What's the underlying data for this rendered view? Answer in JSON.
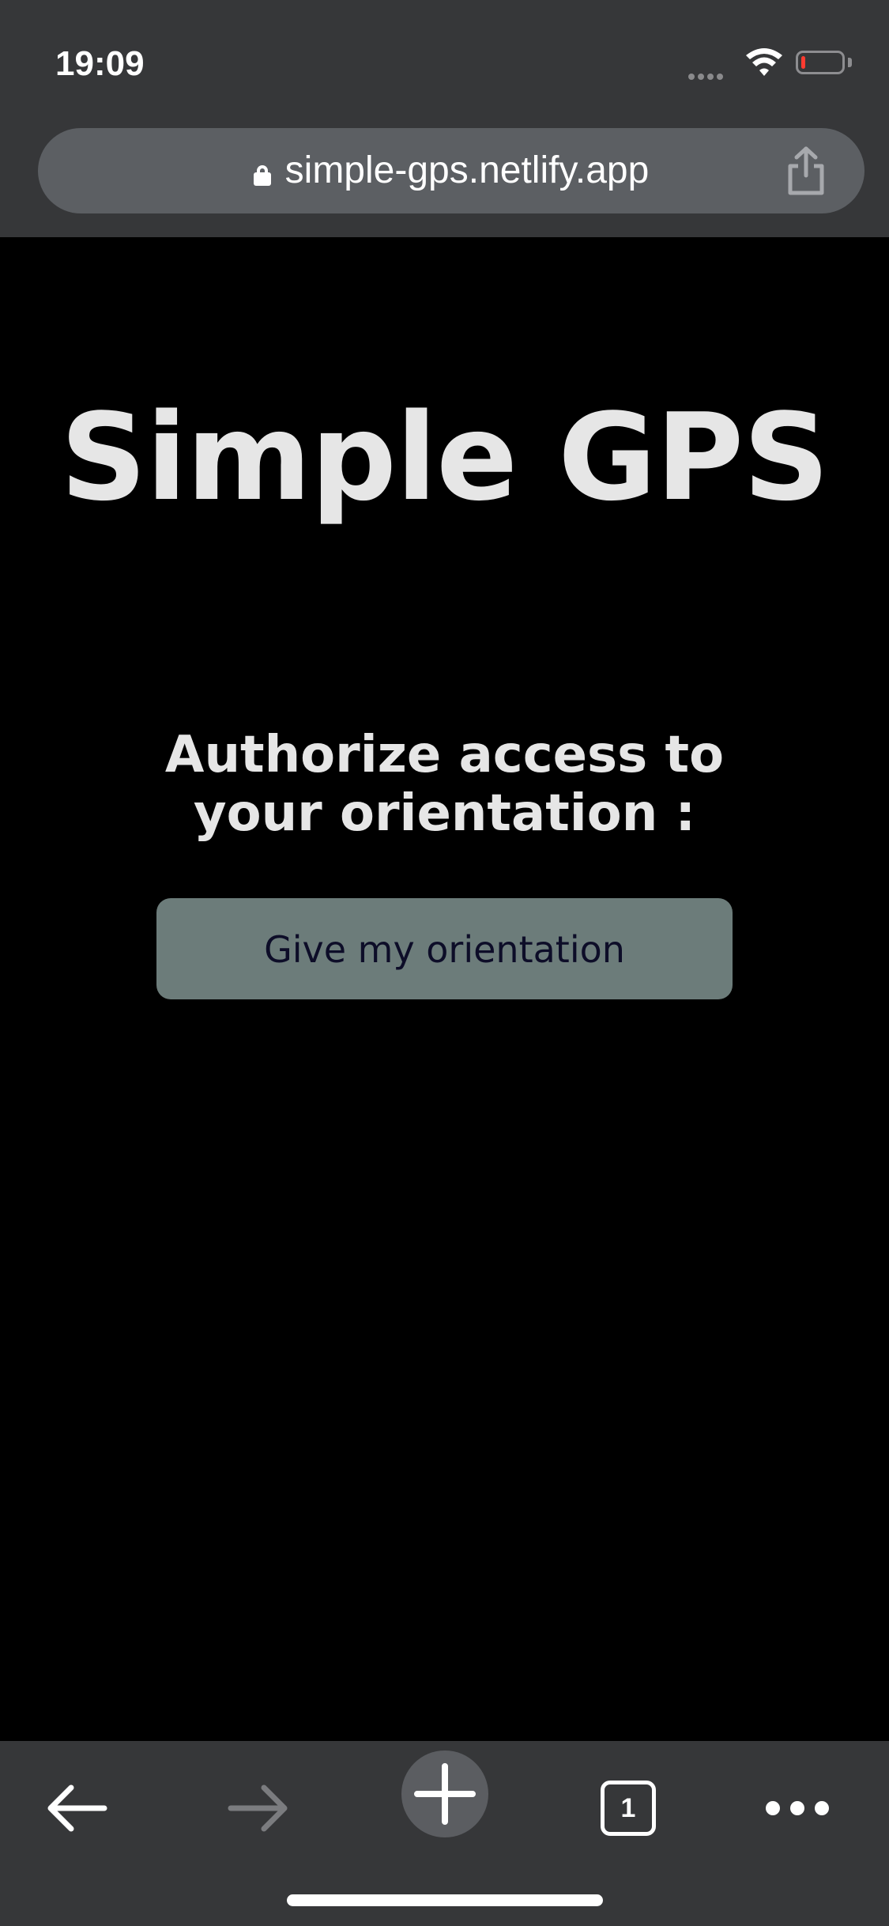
{
  "status_bar": {
    "time": "19:09",
    "battery_level_percent": 10,
    "battery_color": "#ff3b30"
  },
  "browser": {
    "url": "simple-gps.netlify.app",
    "icons": {
      "lock": "lock-icon",
      "share": "share-icon",
      "back": "back-arrow-icon",
      "forward": "forward-arrow-icon",
      "new_tab": "plus-icon",
      "more": "more-dots-icon"
    },
    "tab_count": "1"
  },
  "page": {
    "title": "Simple GPS",
    "prompt_line1": "Authorize access to",
    "prompt_line2": "your orientation :",
    "button_label": "Give my orientation",
    "colors": {
      "background": "#000000",
      "text": "#e6e6e6",
      "button_bg": "#6c7c7a",
      "button_text": "#0d0d28"
    }
  }
}
